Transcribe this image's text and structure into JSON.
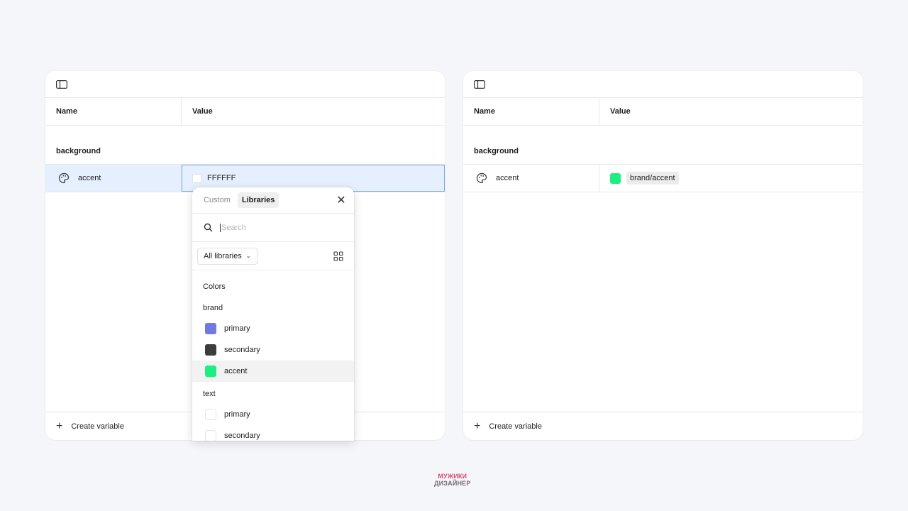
{
  "left_panel": {
    "columns": {
      "name": "Name",
      "value": "Value"
    },
    "group": "background",
    "variable": {
      "name": "accent",
      "value": "FFFFFF"
    },
    "footer": {
      "create_label": "Create variable"
    }
  },
  "popover": {
    "tabs": [
      {
        "label": "Custom",
        "active": false
      },
      {
        "label": "Libraries",
        "active": true
      }
    ],
    "search": {
      "placeholder": "Search"
    },
    "library_filter": "All libraries",
    "section": "Colors",
    "groups": [
      {
        "name": "brand",
        "items": [
          {
            "label": "primary",
            "color": "#6f78e3"
          },
          {
            "label": "secondary",
            "color": "#3f3c3c"
          },
          {
            "label": "accent",
            "color": "#1bef82"
          }
        ]
      },
      {
        "name": "text",
        "items": [
          {
            "label": "primary",
            "color": "#ffffff"
          },
          {
            "label": "secondary",
            "color": "#ffffff"
          }
        ]
      }
    ]
  },
  "right_panel": {
    "columns": {
      "name": "Name",
      "value": "Value"
    },
    "group": "background",
    "variable": {
      "name": "accent",
      "value": "brand/accent",
      "color": "#1bef82"
    },
    "footer": {
      "create_label": "Create variable"
    }
  },
  "logo": {
    "line1": "МУЖИКИ",
    "line2": "ДИЗАЙНЕР"
  },
  "colors": {
    "selection_bg": "#e5effd",
    "accent_green": "#1bef82"
  }
}
